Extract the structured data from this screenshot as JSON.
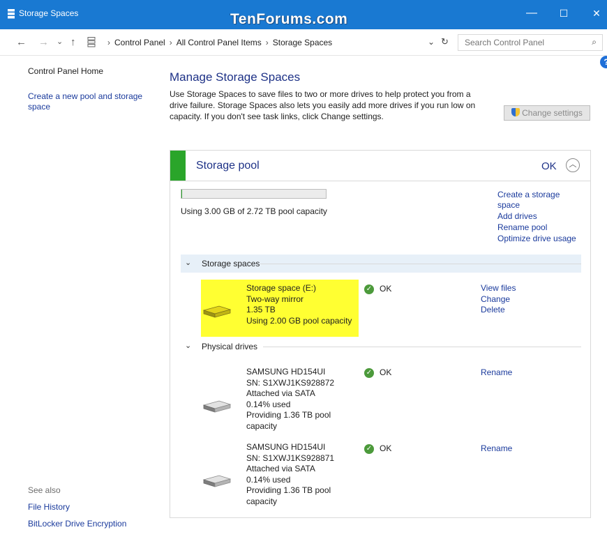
{
  "window": {
    "title": "Storage Spaces",
    "watermark": "TenForums.com",
    "controls": {
      "minimize": "—",
      "maximize": "☐",
      "close": "✕"
    }
  },
  "address_bar": {
    "back": "←",
    "forward": "→",
    "recent": "⌄",
    "up": "↑",
    "breadcrumbs": [
      "Control Panel",
      "All Control Panel Items",
      "Storage Spaces"
    ],
    "separator": "›",
    "dropdown": "⌄",
    "refresh": "↻",
    "search_placeholder": "Search Control Panel",
    "search_icon": "⌕"
  },
  "left_pane": {
    "home": "Control Panel Home",
    "create_link_line1": "Create a new pool and storage",
    "create_link_line2": "space",
    "see_also": "See also",
    "links": [
      "File History",
      "BitLocker Drive Encryption"
    ]
  },
  "main": {
    "help": "?",
    "title": "Manage Storage Spaces",
    "description_lines": [
      "Use Storage Spaces to save files to two or more drives to help protect you from a",
      "drive failure. Storage Spaces also lets you easily add more drives if you run low on",
      "capacity. If you don't see task links, click Change settings."
    ],
    "change_settings": "Change settings"
  },
  "pool": {
    "title": "Storage pool",
    "status": "OK",
    "collapse_glyph": "︿",
    "used_fraction": 0.001,
    "capacity_text": "Using 3.00 GB of 2.72 TB pool capacity",
    "links": [
      "Create a storage",
      "space",
      "Add drives",
      "Rename pool",
      "Optimize drive usage"
    ],
    "storage_spaces_header": "Storage spaces",
    "physical_drives_header": "Physical drives",
    "chevron": "⌄",
    "space": {
      "lines": [
        "Storage space (E:)",
        "Two-way mirror",
        "1.35 TB",
        "Using 2.00 GB pool capacity"
      ],
      "status": "OK",
      "links": [
        "View files",
        "Change",
        "Delete"
      ]
    },
    "drives": [
      {
        "lines": [
          "SAMSUNG HD154UI",
          "SN: S1XWJ1KS928872",
          "Attached via SATA",
          "0.14% used",
          "Providing 1.36 TB pool",
          "capacity"
        ],
        "status": "OK",
        "link": "Rename"
      },
      {
        "lines": [
          "SAMSUNG HD154UI",
          "SN: S1XWJ1KS928871",
          "Attached via SATA",
          "0.14% used",
          "Providing 1.36 TB pool",
          "capacity"
        ],
        "status": "OK",
        "link": "Rename"
      }
    ],
    "check_glyph": "✓"
  },
  "colors": {
    "titlebar": "#1979d2",
    "accent_green": "#2aa52a",
    "highlight_yellow": "#ffff32",
    "link_blue": "#1a3a9c",
    "heading_blue": "#1e3287"
  }
}
